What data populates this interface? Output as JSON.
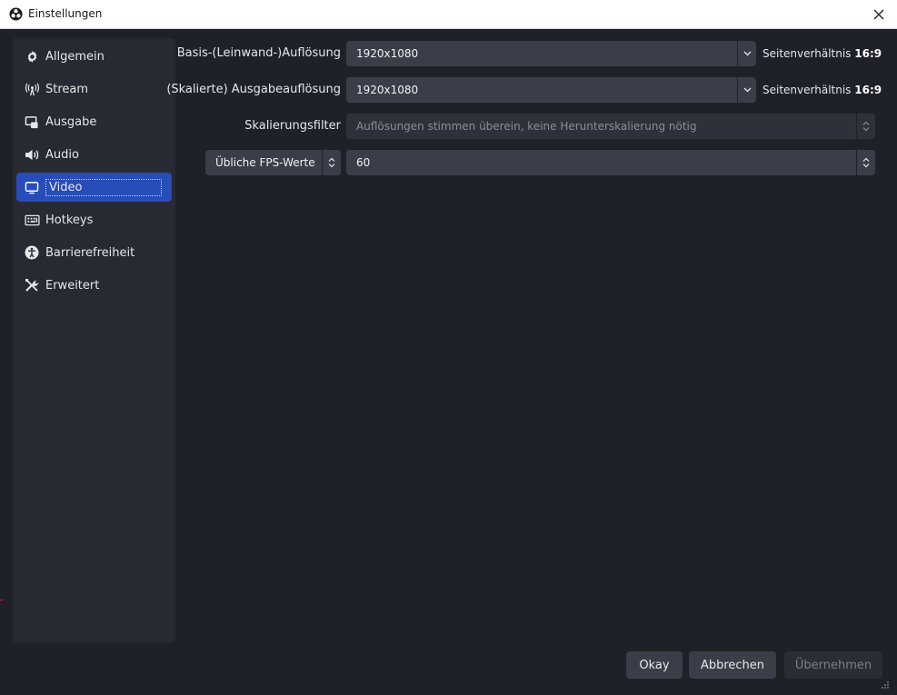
{
  "window": {
    "title": "Einstellungen",
    "close_icon": "close-icon",
    "app_icon": "obs-logo-icon"
  },
  "sidebar": {
    "items": [
      {
        "label": "Allgemein",
        "icon": "gear-icon"
      },
      {
        "label": "Stream",
        "icon": "broadcast-icon"
      },
      {
        "label": "Ausgabe",
        "icon": "output-icon"
      },
      {
        "label": "Audio",
        "icon": "speaker-icon"
      },
      {
        "label": "Video",
        "icon": "monitor-icon"
      },
      {
        "label": "Hotkeys",
        "icon": "keyboard-icon"
      },
      {
        "label": "Barrierefreiheit",
        "icon": "accessibility-icon"
      },
      {
        "label": "Erweitert",
        "icon": "tools-icon"
      }
    ],
    "active": "Video"
  },
  "video": {
    "base_resolution": {
      "label": "Basis-(Leinwand-)Auflösung",
      "value": "1920x1080",
      "aspect_prefix": "Seitenverhältnis",
      "aspect_value": "16:9"
    },
    "output_resolution": {
      "label": "(Skalierte) Ausgabeauflösung",
      "value": "1920x1080",
      "aspect_prefix": "Seitenverhältnis",
      "aspect_value": "16:9"
    },
    "scale_filter": {
      "label": "Skalierungsfilter",
      "value": "Auflösungen stimmen überein, keine Herunterskalierung nötig"
    },
    "fps": {
      "type_value": "Übliche FPS-Werte",
      "value": "60"
    }
  },
  "buttons": {
    "ok": "Okay",
    "cancel": "Abbrechen",
    "apply": "Übernehmen"
  },
  "colors": {
    "background": "#1f2129",
    "panel": "#272a33",
    "accent": "#284cb8",
    "field": "#3b3e48"
  }
}
